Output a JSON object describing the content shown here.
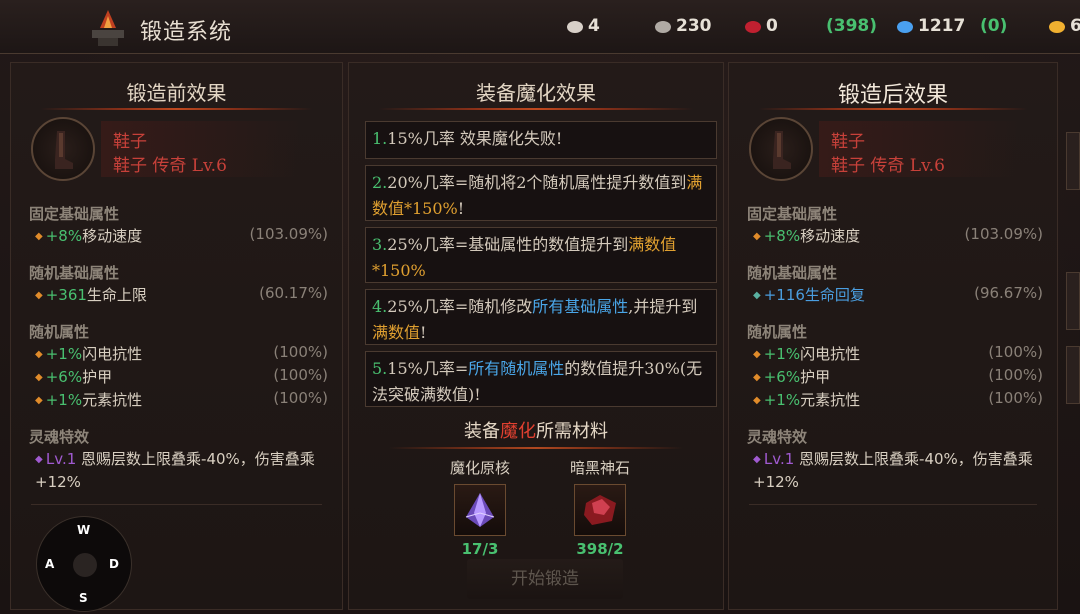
{
  "header": {
    "title": "锻造系统",
    "resources": [
      {
        "icon": "gem-shard-icon",
        "value": "4"
      },
      {
        "icon": "silver-coin-icon",
        "value": "230"
      },
      {
        "icon": "red-ore-icon",
        "value": "0"
      },
      {
        "icon": "",
        "value": "(398)",
        "green": true
      },
      {
        "icon": "blue-crystal-icon",
        "value": "1217"
      },
      {
        "icon": "",
        "value": "(0)",
        "green": true
      },
      {
        "icon": "gold-coin-icon",
        "value": "6"
      }
    ]
  },
  "before": {
    "title": "锻造前效果",
    "item_name": "鞋子",
    "item_sub": "鞋子 传奇 Lv.6",
    "fixed_label": "固定基础属性",
    "fixed": [
      {
        "prefix": "+",
        "num": "8%",
        "name": "移动速度",
        "pct": "(103.09%)"
      }
    ],
    "random_base_label": "随机基础属性",
    "random_base": [
      {
        "prefix": "+",
        "num": "361",
        "name": "生命上限",
        "pct": "(60.17%)"
      }
    ],
    "random_label": "随机属性",
    "random": [
      {
        "prefix": "+",
        "num": "1%",
        "name": "闪电抗性",
        "pct": "(100%)"
      },
      {
        "prefix": "+",
        "num": "6%",
        "name": "护甲",
        "pct": "(100%)"
      },
      {
        "prefix": "+",
        "num": "1%",
        "name": "元素抗性",
        "pct": "(100%)"
      }
    ],
    "soul_label": "灵魂特效",
    "soul_lv": "Lv.1",
    "soul_text": " 恩赐层数上限叠乘-40%，伤害叠乘+12%"
  },
  "after": {
    "title": "锻造后效果",
    "item_name": "鞋子",
    "item_sub": "鞋子 传奇 Lv.6",
    "fixed_label": "固定基础属性",
    "fixed": [
      {
        "prefix": "+",
        "num": "8%",
        "name": "移动速度",
        "pct": "(103.09%)"
      }
    ],
    "random_base_label": "随机基础属性",
    "random_base": [
      {
        "prefix": "+",
        "num": "116",
        "name": "生命回复",
        "pct": "(96.67%)"
      }
    ],
    "random_label": "随机属性",
    "random": [
      {
        "prefix": "+",
        "num": "1%",
        "name": "闪电抗性",
        "pct": "(100%)"
      },
      {
        "prefix": "+",
        "num": "6%",
        "name": "护甲",
        "pct": "(100%)"
      },
      {
        "prefix": "+",
        "num": "1%",
        "name": "元素抗性",
        "pct": "(100%)"
      }
    ],
    "soul_label": "灵魂特效",
    "soul_lv": "Lv.1",
    "soul_text": " 恩赐层数上限叠乘-40%，伤害叠乘+12%"
  },
  "enchant": {
    "title": "装备魔化效果",
    "effects": [
      {
        "n": "1.",
        "parts": [
          {
            "t": "15%几率 效果魔化失败!",
            "c": ""
          }
        ]
      },
      {
        "n": "2.",
        "parts": [
          {
            "t": "20%几率=随机将2个随机属性提升数值到",
            "c": ""
          },
          {
            "t": "满数值*150%",
            "c": "o"
          },
          {
            "t": "!",
            "c": ""
          }
        ]
      },
      {
        "n": "3.",
        "parts": [
          {
            "t": "25%几率=基础属性的数值提升到",
            "c": ""
          },
          {
            "t": "满数值*150%",
            "c": "o"
          }
        ]
      },
      {
        "n": "4.",
        "parts": [
          {
            "t": "25%几率=随机修改",
            "c": ""
          },
          {
            "t": "所有基础属性",
            "c": "b"
          },
          {
            "t": ",并提升到",
            "c": ""
          },
          {
            "t": "满数值",
            "c": "o"
          },
          {
            "t": "!",
            "c": ""
          }
        ]
      },
      {
        "n": "5.",
        "parts": [
          {
            "t": "15%几率=",
            "c": ""
          },
          {
            "t": "所有随机属性",
            "c": "b"
          },
          {
            "t": "的数值提升30%(无法突破满数值)!",
            "c": ""
          }
        ]
      }
    ],
    "materials_title_a": "装备",
    "materials_title_b": "魔化",
    "materials_title_c": "所需材料",
    "materials": [
      {
        "name": "魔化原核",
        "count": "17/3",
        "icon": "purple-crystal-icon"
      },
      {
        "name": "暗黑神石",
        "count": "398/2",
        "icon": "red-stone-icon"
      }
    ],
    "start_label": "开始锻造"
  },
  "joystick": {
    "up": "W",
    "left": "A",
    "right": "D",
    "down": "S"
  },
  "colors": {
    "green": "#49c070",
    "orange": "#e0a030",
    "blue": "#4aa6e8",
    "red_item": "#c8413a",
    "purple": "#a05ad0"
  }
}
